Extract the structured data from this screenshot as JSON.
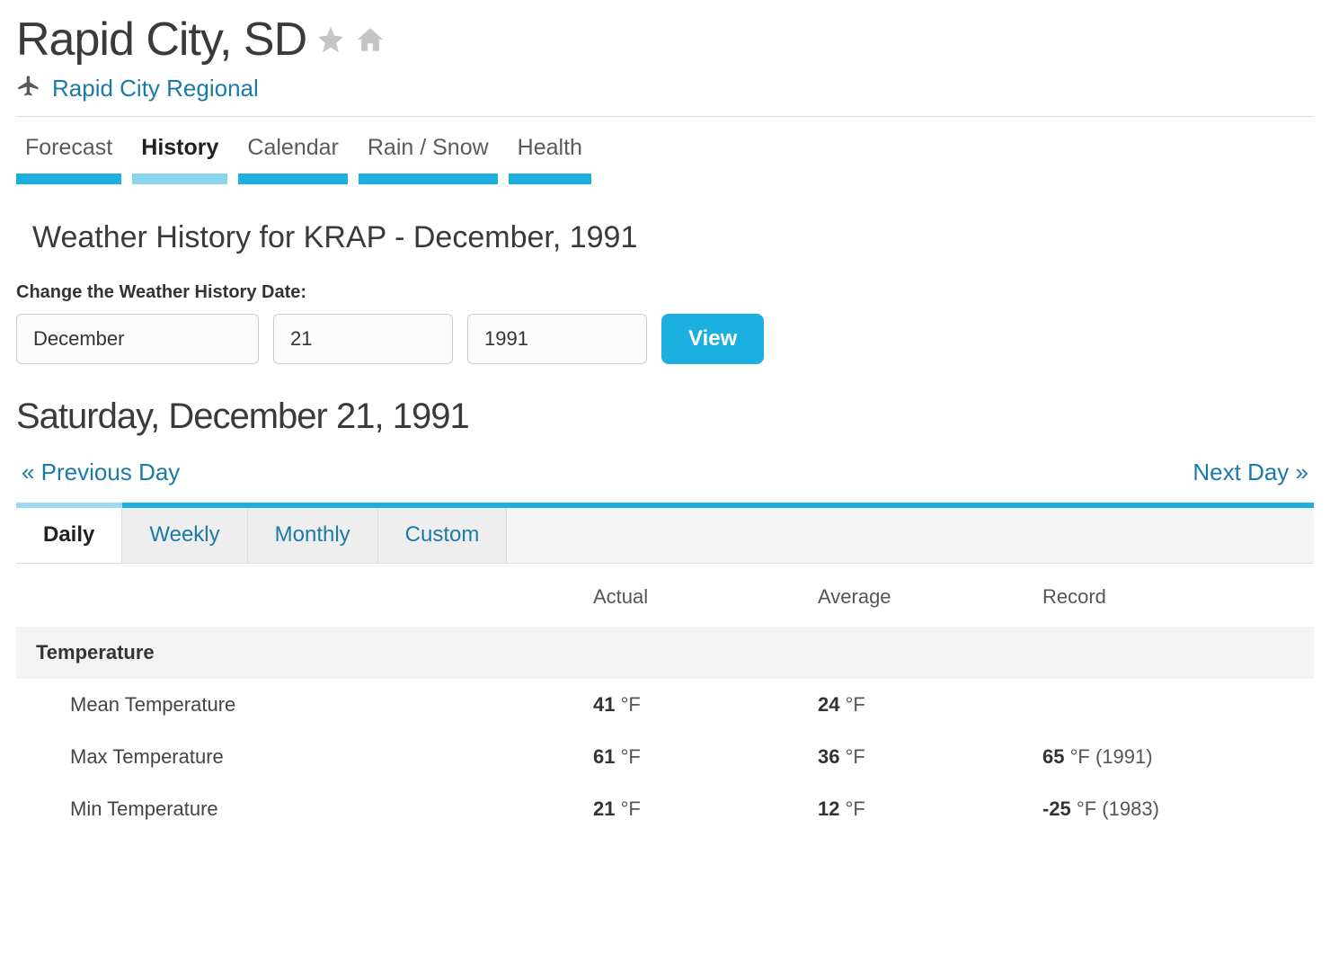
{
  "location": {
    "city_state": "Rapid City, SD",
    "airport_name": "Rapid City Regional"
  },
  "main_nav": {
    "items": [
      {
        "label": "Forecast"
      },
      {
        "label": "History",
        "active": true
      },
      {
        "label": "Calendar"
      },
      {
        "label": "Rain / Snow"
      },
      {
        "label": "Health"
      }
    ]
  },
  "history": {
    "heading": "Weather History for KRAP - December, 1991",
    "change_label": "Change the Weather History Date:",
    "select_month": "December",
    "select_day": "21",
    "select_year": "1991",
    "view_button": "View",
    "day_heading": "Saturday, December 21, 1991",
    "prev_link": "« Previous Day",
    "next_link": "Next Day »"
  },
  "period_tabs": [
    {
      "label": "Daily",
      "active": true
    },
    {
      "label": "Weekly"
    },
    {
      "label": "Monthly"
    },
    {
      "label": "Custom"
    }
  ],
  "table": {
    "headers": {
      "actual": "Actual",
      "average": "Average",
      "record": "Record"
    },
    "section_temperature": "Temperature",
    "unit": "°F",
    "rows": [
      {
        "label": "Mean Temperature",
        "actual": "41",
        "average": "24",
        "record": "",
        "record_year": ""
      },
      {
        "label": "Max Temperature",
        "actual": "61",
        "average": "36",
        "record": "65",
        "record_year": "(1991)"
      },
      {
        "label": "Min Temperature",
        "actual": "21",
        "average": "12",
        "record": "-25",
        "record_year": "(1983)"
      }
    ]
  }
}
